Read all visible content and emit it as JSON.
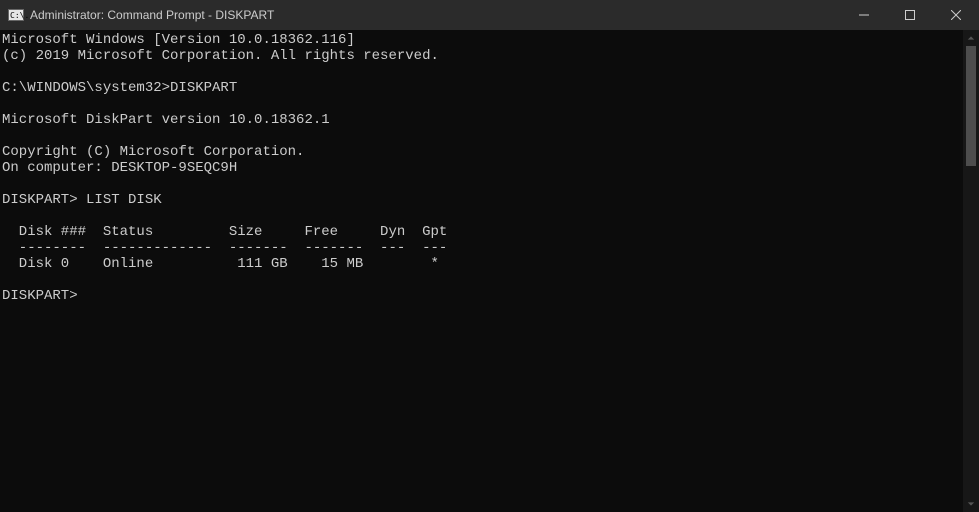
{
  "window": {
    "title": "Administrator: Command Prompt - DISKPART",
    "icon_name": "cmd-prompt-icon"
  },
  "terminal": {
    "lines": [
      "Microsoft Windows [Version 10.0.18362.116]",
      "(c) 2019 Microsoft Corporation. All rights reserved.",
      "",
      "C:\\WINDOWS\\system32>DISKPART",
      "",
      "Microsoft DiskPart version 10.0.18362.1",
      "",
      "Copyright (C) Microsoft Corporation.",
      "On computer: DESKTOP-9SEQC9H",
      "",
      "DISKPART> LIST DISK",
      "",
      "  Disk ###  Status         Size     Free     Dyn  Gpt",
      "  --------  -------------  -------  -------  ---  ---",
      "  Disk 0    Online          111 GB    15 MB        *",
      "",
      "DISKPART>"
    ]
  },
  "disks": [
    {
      "id": "Disk 0",
      "status": "Online",
      "size": "111 GB",
      "free": "15 MB",
      "dyn": "",
      "gpt": "*"
    }
  ],
  "cmd_glyph_text": "C:\\."
}
